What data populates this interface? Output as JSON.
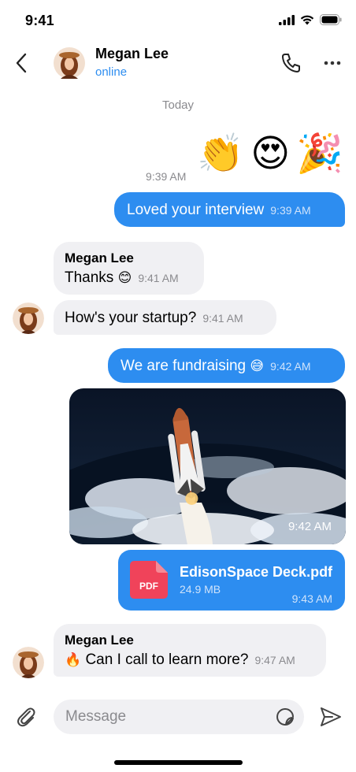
{
  "status_bar": {
    "time": "9:41"
  },
  "header": {
    "name": "Megan Lee",
    "status": "online"
  },
  "date_separator": "Today",
  "messages": {
    "emoji_row": {
      "time": "9:39 AM",
      "emojis": [
        "👏",
        "😍",
        "🎉"
      ]
    },
    "m1": {
      "text": "Loved your interview",
      "time": "9:39 AM"
    },
    "m2": {
      "sender": "Megan Lee",
      "text": "Thanks",
      "emoji": "😊",
      "time": "9:41 AM"
    },
    "m3": {
      "text": "How's your startup?",
      "time": "9:41 AM"
    },
    "m4": {
      "text": "We are fundraising",
      "emoji": "😅",
      "time": "9:42 AM"
    },
    "m5": {
      "time": "9:42 AM"
    },
    "m6": {
      "file_name": "EdisonSpace Deck.pdf",
      "file_size": "24.9 MB",
      "file_type": "PDF",
      "time": "9:43 AM"
    },
    "m7": {
      "sender": "Megan Lee",
      "emoji": "🔥",
      "text": "Can I call to learn more?",
      "time": "9:47 AM"
    }
  },
  "composer": {
    "placeholder": "Message"
  },
  "colors": {
    "accent": "#2d8df0",
    "incoming_bubble": "#f0f0f3",
    "pdf": "#f0435a"
  }
}
